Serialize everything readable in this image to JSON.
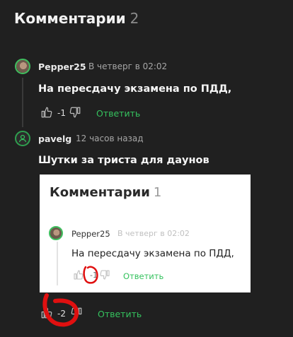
{
  "header": {
    "title": "Комментарии",
    "count": "2"
  },
  "comments": [
    {
      "author": "Pepper25",
      "time": "В четверг в 02:02",
      "text": "На пересдачу экзамена по ПДД,",
      "score": "-1",
      "reply_label": "Ответить"
    },
    {
      "author": "pavelg",
      "time": "12 часов назад",
      "text": "Шутки за триста для даунов",
      "score": "-2",
      "reply_label": "Ответить"
    }
  ],
  "embedded_screenshot": {
    "title": "Комментарии",
    "count": "1",
    "comment": {
      "author": "Pepper25",
      "time": "В четверг в 02:02",
      "text": "На пересдачу экзамена по ПДД,",
      "score": "-1",
      "reply_label": "Ответить"
    }
  },
  "colors": {
    "background": "#202020",
    "accent_green": "#35c25e",
    "annotation_red": "#e01010"
  },
  "icons": [
    "thumbs-up-icon",
    "thumbs-down-icon",
    "user-icon"
  ]
}
